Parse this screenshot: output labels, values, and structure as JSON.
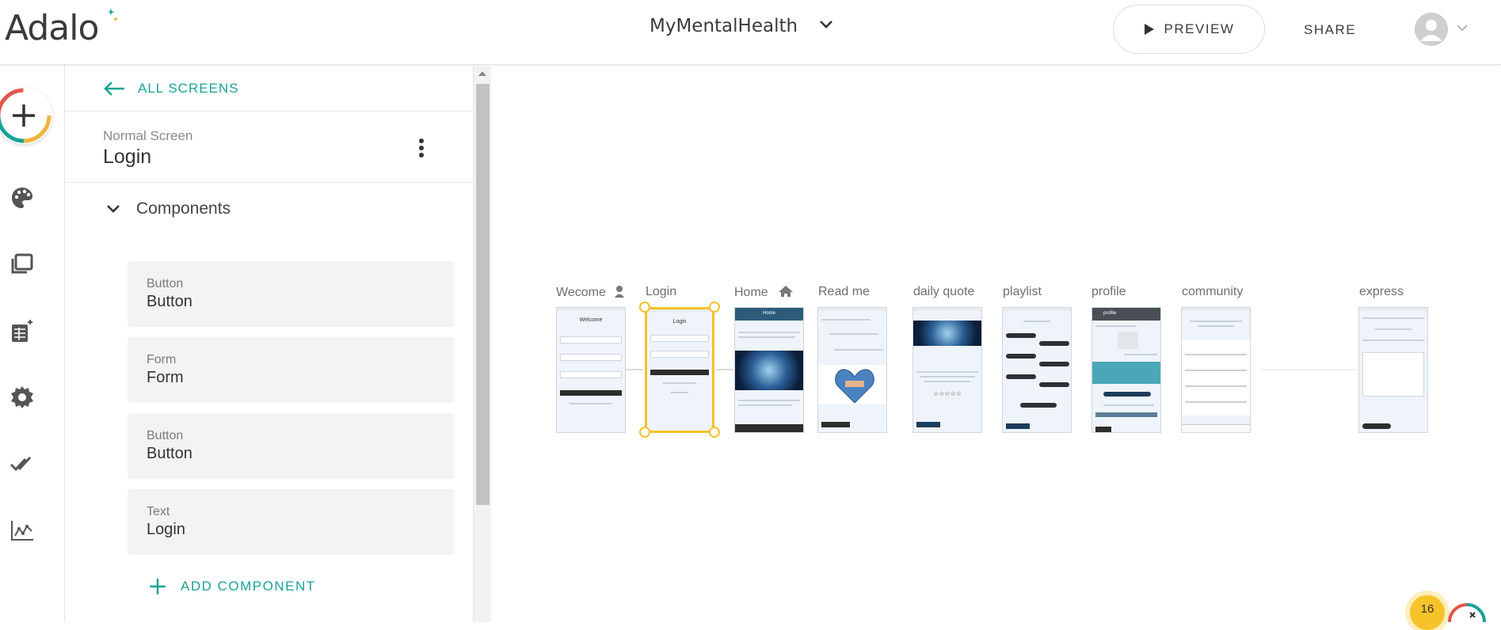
{
  "brand": {
    "logo_text": "Adalo"
  },
  "header": {
    "app_name": "MyMentalHealth",
    "preview_label": "PREVIEW",
    "share_label": "SHARE"
  },
  "rail": {
    "icons": [
      "add-icon",
      "palette-icon",
      "screens-icon",
      "database-icon",
      "gear-icon",
      "double-check-icon",
      "analytics-icon"
    ]
  },
  "panel": {
    "back_label": "ALL SCREENS",
    "screen_type": "Normal Screen",
    "screen_name": "Login",
    "components_label": "Components",
    "components": [
      {
        "type": "Button",
        "name": "Button"
      },
      {
        "type": "Form",
        "name": "Form"
      },
      {
        "type": "Button",
        "name": "Button"
      },
      {
        "type": "Text",
        "name": "Login"
      }
    ],
    "add_component_label": "ADD COMPONENT"
  },
  "canvas": {
    "screens": [
      {
        "label": "Wecome",
        "title": "Welcome"
      },
      {
        "label": "Login",
        "title": "Login"
      },
      {
        "label": "Home",
        "title": "Home"
      },
      {
        "label": "Read me"
      },
      {
        "label": "daily quote"
      },
      {
        "label": "playlist"
      },
      {
        "label": "profile",
        "title": "profile"
      },
      {
        "label": "community"
      },
      {
        "label": "express"
      }
    ],
    "selected_screen": "Login"
  },
  "notification_count": "16",
  "colors": {
    "accent": "#17a398",
    "selection": "#f5c12a"
  }
}
